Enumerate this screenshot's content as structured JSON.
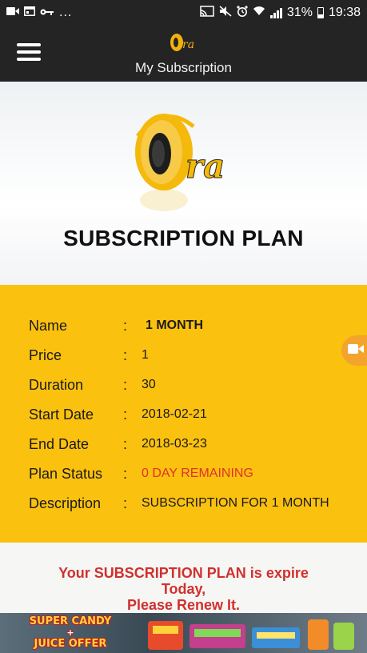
{
  "status_bar": {
    "battery": "31%",
    "time": "19:38",
    "ellipsis": "..."
  },
  "app_bar": {
    "title": "My Subscription",
    "logo_text": "ra"
  },
  "header": {
    "logo_text": "ra",
    "heading": "SUBSCRIPTION PLAN"
  },
  "details": {
    "colon": ":",
    "rows": [
      {
        "label": "Name",
        "value": "1 MONTH"
      },
      {
        "label": "Price",
        "value": "1"
      },
      {
        "label": "Duration",
        "value": "30"
      },
      {
        "label": "Start Date",
        "value": "2018-02-21"
      },
      {
        "label": "End Date",
        "value": "2018-03-23"
      },
      {
        "label": "Plan Status",
        "value": "0 DAY REMAINING"
      },
      {
        "label": "Description",
        "value": "SUBSCRIPTION FOR 1 MONTH"
      }
    ]
  },
  "message": {
    "line1": "Your SUBSCRIPTION PLAN is expire",
    "line2": "Today,",
    "line3": "Please Renew It."
  },
  "ad": {
    "line1": "SUPER CANDY",
    "plus": "+",
    "line2": "JUICE OFFER"
  },
  "colors": {
    "bar_bg": "#242424",
    "accent_yellow": "#fbc10f",
    "status_red": "#e0312a"
  }
}
